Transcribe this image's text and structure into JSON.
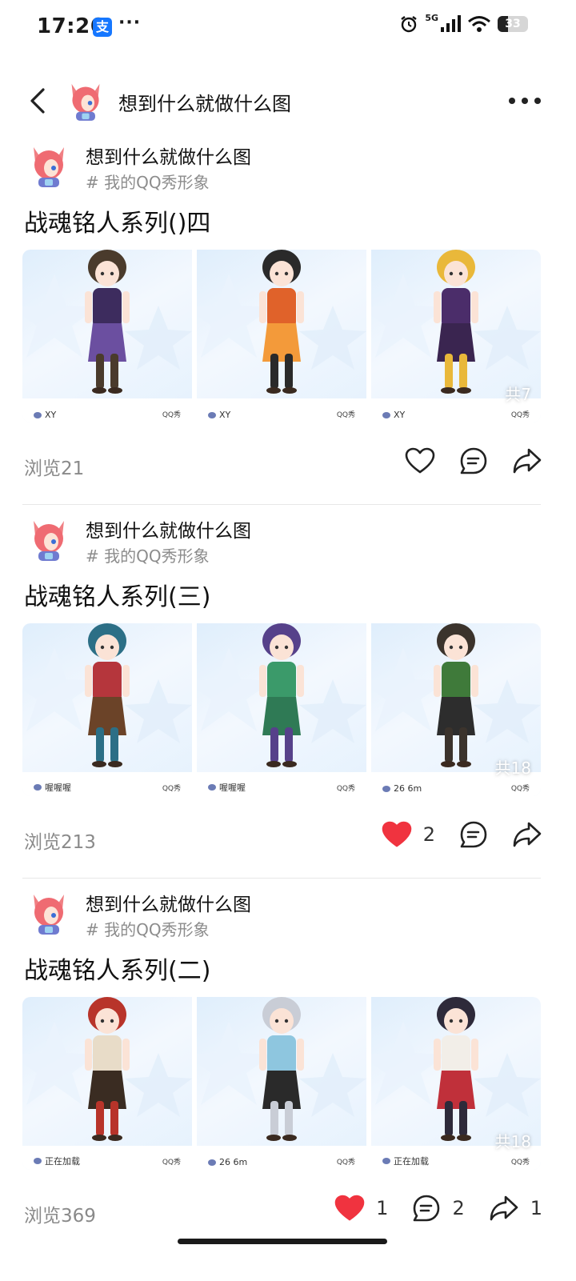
{
  "status_bar": {
    "time": "17:26",
    "pay_glyph": "支",
    "more_dots": "···",
    "network": "5G",
    "battery": "33",
    "battery_level_percent": 33
  },
  "header": {
    "title": "想到什么就做什么图"
  },
  "posts": [
    {
      "author": "想到什么就做什么图",
      "tag": "# 我的QQ秀形象",
      "title": "战魂铭人系列()四",
      "images": [
        {
          "wm_left": "XY",
          "wm_right": "QQ秀",
          "count": ""
        },
        {
          "wm_left": "XY",
          "wm_right": "QQ秀",
          "count": ""
        },
        {
          "wm_left": "XY",
          "wm_right": "QQ秀",
          "count": "共7"
        }
      ],
      "views": "浏览21",
      "likes": "",
      "comments": "",
      "shares": "",
      "liked": false
    },
    {
      "author": "想到什么就做什么图",
      "tag": "# 我的QQ秀形象",
      "title": "战魂铭人系列(三)",
      "images": [
        {
          "wm_left": "喔喔喔",
          "wm_right": "QQ秀",
          "count": ""
        },
        {
          "wm_left": "喔喔喔",
          "wm_right": "QQ秀",
          "count": ""
        },
        {
          "wm_left": "26 6m",
          "wm_right": "QQ秀",
          "count": "共18"
        }
      ],
      "views": "浏览213",
      "likes": "2",
      "comments": "",
      "shares": "",
      "liked": true
    },
    {
      "author": "想到什么就做什么图",
      "tag": "# 我的QQ秀形象",
      "title": "战魂铭人系列(二)",
      "images": [
        {
          "wm_left": "正在加载",
          "wm_right": "QQ秀",
          "count": ""
        },
        {
          "wm_left": "26 6m",
          "wm_right": "QQ秀",
          "count": ""
        },
        {
          "wm_left": "正在加载",
          "wm_right": "QQ秀",
          "count": "共18"
        }
      ],
      "views": "浏览369",
      "likes": "1",
      "comments": "2",
      "shares": "1",
      "liked": true
    }
  ],
  "colors": {
    "liked_red": "#f0333f",
    "muted_text": "#8a8a8a",
    "tile_bg": "#e6f2fd"
  },
  "icons": {
    "back": "chevron-left-icon",
    "more": "more-dots-icon",
    "like": "heart-icon",
    "comment": "comment-bubble-icon",
    "share": "share-arrow-icon"
  }
}
